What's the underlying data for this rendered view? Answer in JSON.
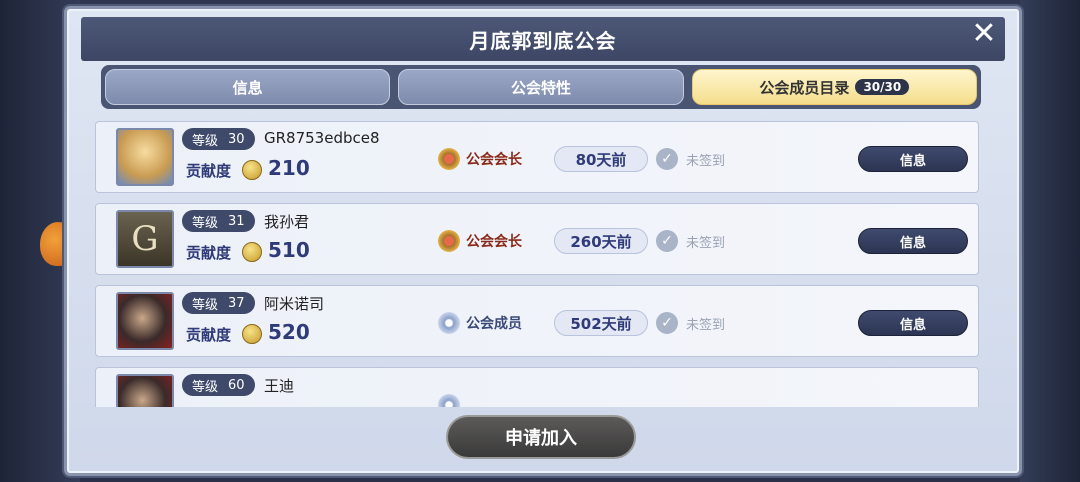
{
  "title": "月底郭到底公会",
  "tabs": [
    {
      "label": "信息"
    },
    {
      "label": "公会特性"
    },
    {
      "label": "公会成员目录",
      "count": "30/30"
    }
  ],
  "contrib_label": "贡献度",
  "level_label": "等级",
  "members": [
    {
      "level": "30",
      "name": "GR8753edbce8",
      "contribution": "210",
      "role": "公会会长",
      "last_seen": "80天前",
      "sign_status": "未签到",
      "action": "信息"
    },
    {
      "level": "31",
      "name": "我孙君",
      "contribution": "510",
      "role": "公会会长",
      "last_seen": "260天前",
      "sign_status": "未签到",
      "action": "信息"
    },
    {
      "level": "37",
      "name": "阿米诺司",
      "contribution": "520",
      "role": "公会成员",
      "last_seen": "502天前",
      "sign_status": "未签到",
      "action": "信息"
    },
    {
      "level": "60",
      "name": "王迪",
      "contribution": "",
      "role": "",
      "last_seen": "",
      "sign_status": "",
      "action": ""
    }
  ],
  "join_button": "申请加入",
  "icons": {
    "close": "close-icon",
    "coin": "coin-icon",
    "leader": "leader-badge-icon",
    "member": "member-badge-icon",
    "check": "check-icon"
  }
}
